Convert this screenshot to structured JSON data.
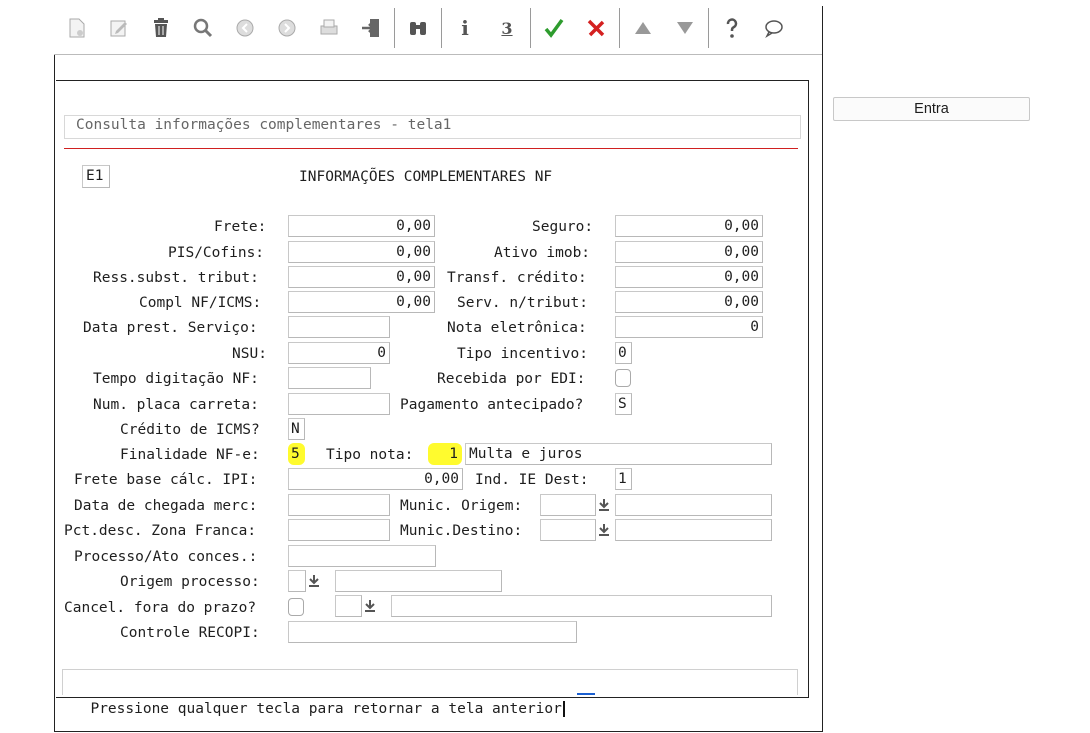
{
  "toolbar": {
    "icons": [
      "new-doc-icon",
      "edit-icon",
      "trash-icon",
      "search-icon",
      "prev-icon",
      "next-icon",
      "print-icon",
      "exit-icon",
      "binoculars-icon",
      "info-icon",
      "counter-icon",
      "confirm-icon",
      "cancel-icon",
      "up-icon",
      "down-icon",
      "help-icon",
      "chat-icon"
    ],
    "info_label": "i",
    "counter_label": "3"
  },
  "entra_button": "Entra",
  "screen": {
    "title": "Consulta informações complementares - tela1",
    "code": "E1",
    "heading": "INFORMAÇÕES COMPLEMENTARES NF",
    "footer": "Pressione qualquer tecla para retornar a tela anterior"
  },
  "fields": {
    "frete": {
      "label": "Frete:",
      "value": "0,00"
    },
    "seguro": {
      "label": "Seguro:",
      "value": "0,00"
    },
    "pis_cofins": {
      "label": "PIS/Cofins:",
      "value": "0,00"
    },
    "ativo_imob": {
      "label": "Ativo imob:",
      "value": "0,00"
    },
    "ress_subst": {
      "label": "Ress.subst. tribut:",
      "value": "0,00"
    },
    "transf_credito": {
      "label": "Transf. crédito:",
      "value": "0,00"
    },
    "compl_nf": {
      "label": "Compl NF/ICMS:",
      "value": "0,00"
    },
    "serv_ntribut": {
      "label": "Serv. n/tribut:",
      "value": "0,00"
    },
    "data_prest": {
      "label": "Data prest. Serviço:",
      "value": ""
    },
    "nota_eletronica": {
      "label": "Nota eletrônica:",
      "value": "0"
    },
    "nsu": {
      "label": "NSU:",
      "value": "0"
    },
    "tipo_incentivo": {
      "label": "Tipo incentivo:",
      "value": "0"
    },
    "tempo_digitacao": {
      "label": "Tempo digitação NF:",
      "value": ""
    },
    "recebida_edi": {
      "label": "Recebida por EDI:",
      "checked": false
    },
    "num_placa": {
      "label": "Num. placa carreta:",
      "value": ""
    },
    "pagamento_antecipado": {
      "label": "Pagamento antecipado?",
      "value": "S"
    },
    "credito_icms": {
      "label": "Crédito de ICMS?",
      "value": "N"
    },
    "finalidade_nfe": {
      "label": "Finalidade NF-e:",
      "value": "5"
    },
    "tipo_nota": {
      "label": "Tipo nota:",
      "value": "1",
      "description": "Multa e juros"
    },
    "frete_base_ipi": {
      "label": "Frete base cálc. IPI:",
      "value": "0,00"
    },
    "ind_ie_dest": {
      "label": "Ind. IE Dest:",
      "value": "1"
    },
    "data_chegada": {
      "label": "Data de chegada merc:",
      "value": ""
    },
    "munic_origem": {
      "label": "Munic. Origem:",
      "value": "",
      "description": ""
    },
    "pct_desc": {
      "label": "Pct.desc. Zona Franca:",
      "value": ""
    },
    "munic_destino": {
      "label": "Munic.Destino:",
      "value": "",
      "description": ""
    },
    "processo_ato": {
      "label": "Processo/Ato conces.:",
      "value": ""
    },
    "origem_processo": {
      "label": "Origem processo:",
      "value": "",
      "description": ""
    },
    "cancel_fora_prazo": {
      "label": "Cancel. fora do prazo?",
      "checked": false,
      "value": "",
      "description": ""
    },
    "controle_recopi": {
      "label": "Controle RECOPI:",
      "value": ""
    }
  },
  "colors": {
    "highlight": "#fffb2e",
    "confirm": "#2e9c2e",
    "cancel": "#d42020",
    "separator": "#d02020"
  }
}
